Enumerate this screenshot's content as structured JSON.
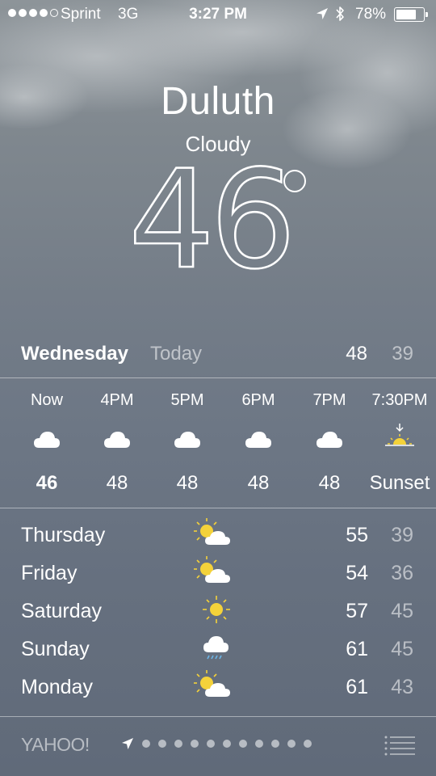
{
  "status_bar": {
    "carrier": "Sprint",
    "network": "3G",
    "time": "3:27 PM",
    "battery_pct": "78%",
    "battery_level": 0.78,
    "signal_bars_filled": 4,
    "signal_bars_total": 5
  },
  "current": {
    "city": "Duluth",
    "condition": "Cloudy",
    "temperature": "46"
  },
  "today": {
    "day": "Wednesday",
    "label": "Today",
    "high": "48",
    "low": "39"
  },
  "hourly": [
    {
      "label": "Now",
      "icon": "cloud-icon",
      "temp": "46"
    },
    {
      "label": "4PM",
      "icon": "cloud-icon",
      "temp": "48"
    },
    {
      "label": "5PM",
      "icon": "cloud-icon",
      "temp": "48"
    },
    {
      "label": "6PM",
      "icon": "cloud-icon",
      "temp": "48"
    },
    {
      "label": "7PM",
      "icon": "cloud-icon",
      "temp": "48"
    },
    {
      "label": "7:30PM",
      "icon": "sunset-icon",
      "temp": "Sunset"
    }
  ],
  "daily": [
    {
      "day": "Thursday",
      "icon": "partly-cloudy-icon",
      "high": "55",
      "low": "39"
    },
    {
      "day": "Friday",
      "icon": "partly-cloudy-icon",
      "high": "54",
      "low": "36"
    },
    {
      "day": "Saturday",
      "icon": "sun-icon",
      "high": "57",
      "low": "45"
    },
    {
      "day": "Sunday",
      "icon": "rain-icon",
      "high": "61",
      "low": "45"
    },
    {
      "day": "Monday",
      "icon": "partly-cloudy-icon",
      "high": "61",
      "low": "43"
    }
  ],
  "footer": {
    "brand": "YAHOO!",
    "page_dots": 11
  },
  "colors": {
    "sun": "#f4d23a",
    "rain": "#6cb6e8",
    "muted_text": "rgba(255,255,255,0.55)"
  }
}
